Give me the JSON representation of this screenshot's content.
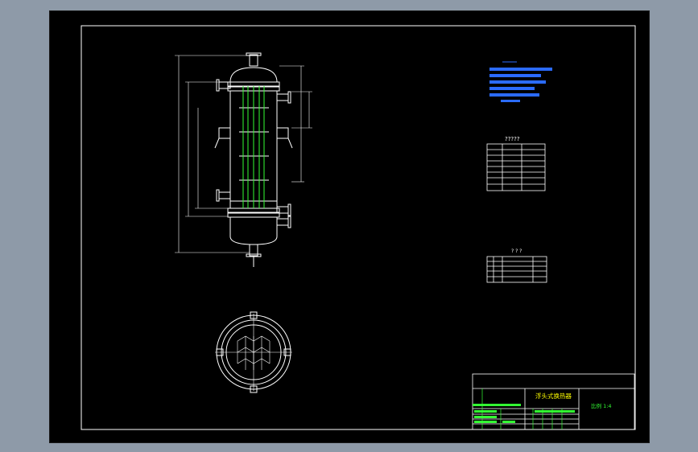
{
  "tables": {
    "top_title": "?????",
    "bottom_title": "? ? ?"
  },
  "title_block": {
    "drawing_name": "浮头式换热器",
    "scale_text": "比例  1:4"
  },
  "colors": {
    "background": "#000000",
    "frame": "#ffffff",
    "vessel": "#ffffff",
    "tubes": "#33ff33",
    "notes": "#2b6bff",
    "dimensions": "#ffffff"
  }
}
